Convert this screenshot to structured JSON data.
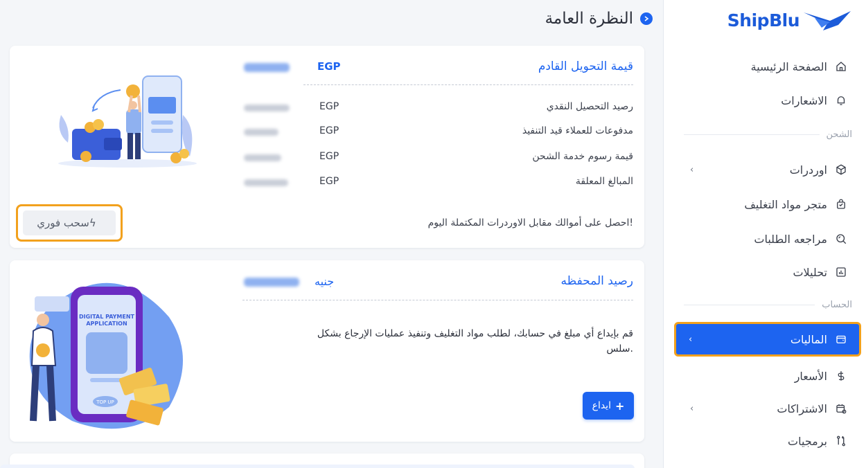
{
  "brand": {
    "name": "ShipBlu"
  },
  "header": {
    "title": "النظرة العامة"
  },
  "sidebar": {
    "items": [
      {
        "label": "الصفحة الرئيسية",
        "icon": "home-icon"
      },
      {
        "label": "الاشعارات",
        "icon": "bell-icon"
      },
      {
        "label": "اوردرات",
        "icon": "box-icon",
        "has_submenu": true
      },
      {
        "label": "متجر مواد التغليف",
        "icon": "shopping-bag-icon"
      },
      {
        "label": "مراجعه الطلبات",
        "icon": "search-review-icon"
      },
      {
        "label": "تحليلات",
        "icon": "chart-icon"
      },
      {
        "label": "الماليات",
        "icon": "wallet-icon",
        "has_submenu": true,
        "active": true
      },
      {
        "label": "الأسعار",
        "icon": "dollar-icon"
      },
      {
        "label": "الاشتراكات",
        "icon": "calendar-icon",
        "has_submenu": true
      },
      {
        "label": "برمجيات",
        "icon": "api-icon"
      }
    ],
    "sections": {
      "shipping": "الشحن",
      "account": "الحساب"
    },
    "chevron": "‹"
  },
  "card_cash": {
    "title": "قيمة التحويل القادم",
    "title_currency": "EGP",
    "rows": [
      {
        "label": "رصيد التحصيل النقدي",
        "currency": "EGP"
      },
      {
        "label": "مدفوعات للعملاء قيد التنفيذ",
        "currency": "EGP"
      },
      {
        "label": "قيمة رسوم خدمة الشحن",
        "currency": "EGP"
      },
      {
        "label": "المبالغ المعلقة",
        "currency": "EGP"
      }
    ],
    "footer_text": "احصل على أموالك مقابل الاوردرات المكتملة اليوم!",
    "instant_withdraw_label": "سحب فوري"
  },
  "card_wallet": {
    "title": "رصيد المحفظه",
    "title_currency": "جنيه",
    "description_line1": "قم بإيداع أي مبلغ في حسابك، لطلب مواد التغليف وتنفيذ عمليات الإرجاع بشكل",
    "description_line2": "سلس.",
    "deposit_label": "ايداع",
    "phone_text_line1": "DIGITAL PAYMENT",
    "phone_text_line2": "APPLICATION",
    "top_up": "TOP UP"
  },
  "colors": {
    "primary": "#1d64f0",
    "highlight": "#f2a11d"
  }
}
